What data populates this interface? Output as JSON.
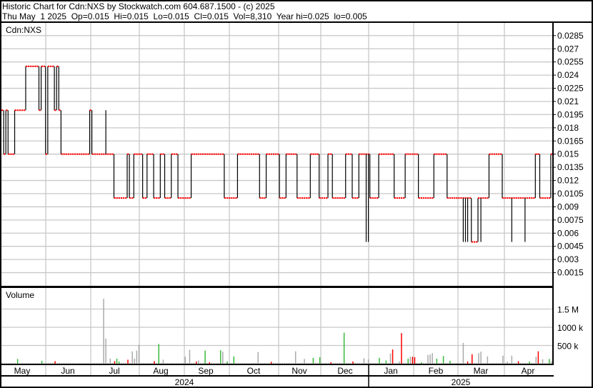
{
  "header": {
    "title": "Historic Chart for Cdn:NXS by Stockwatch.com 604.687.1500 - (c) 2025",
    "quote": "Thu May  1 2025  Op=0.015  Hi=0.015  Lo=0.015  Cl=0.015  Vol=8,310  Year hi=0.025  lo=0.005"
  },
  "colors": {
    "up": "#3cb83c",
    "down": "#ff0000",
    "neutral": "#aaaaaa",
    "close": "#ff0000",
    "range": "#000000",
    "grid": "#c8c8c8"
  },
  "chart_data": [
    {
      "type": "line",
      "title": "Cdn:NXS",
      "ylim": [
        0,
        0.0302
      ],
      "yticks": [
        "0.0285",
        "0.027",
        "0.0255",
        "0.024",
        "0.0225",
        "0.021",
        "0.0195",
        "0.018",
        "0.0165",
        "0.015",
        "0.0135",
        "0.012",
        "0.0105",
        "0.009",
        "0.0075",
        "0.006",
        "0.0045",
        "0.003",
        "0.0015"
      ],
      "trading_days": 250,
      "close_runs": [
        [
          0.02,
          1
        ],
        [
          0.015,
          1
        ],
        [
          0.02,
          1
        ],
        [
          0.015,
          1
        ],
        [
          0.015,
          2
        ],
        [
          0.02,
          5
        ],
        [
          0.025,
          6
        ],
        [
          0.02,
          1
        ],
        [
          0.025,
          2
        ],
        [
          0.015,
          1
        ],
        [
          0.025,
          3
        ],
        [
          0.02,
          1
        ],
        [
          0.025,
          1
        ],
        [
          0.02,
          1
        ],
        [
          0.015,
          13
        ],
        [
          0.02,
          1
        ],
        [
          0.015,
          10
        ],
        [
          0.01,
          6
        ],
        [
          0.015,
          1
        ],
        [
          0.01,
          2
        ],
        [
          0.015,
          4
        ],
        [
          0.01,
          2
        ],
        [
          0.015,
          3
        ],
        [
          0.01,
          3
        ],
        [
          0.015,
          2
        ],
        [
          0.01,
          3
        ],
        [
          0.015,
          3
        ],
        [
          0.01,
          6
        ],
        [
          0.015,
          15
        ],
        [
          0.01,
          6
        ],
        [
          0.015,
          10
        ],
        [
          0.01,
          3
        ],
        [
          0.015,
          6
        ],
        [
          0.01,
          3
        ],
        [
          0.015,
          5
        ],
        [
          0.01,
          6
        ],
        [
          0.015,
          4
        ],
        [
          0.01,
          4
        ],
        [
          0.015,
          2
        ],
        [
          0.01,
          6
        ],
        [
          0.015,
          3
        ],
        [
          0.01,
          3
        ],
        [
          0.015,
          5
        ],
        [
          0.01,
          4
        ],
        [
          0.015,
          7
        ],
        [
          0.01,
          5
        ],
        [
          0.015,
          6
        ],
        [
          0.01,
          7
        ],
        [
          0.015,
          6
        ],
        [
          0.01,
          8
        ],
        [
          0.01,
          3
        ],
        [
          0.005,
          3
        ],
        [
          0.01,
          5
        ],
        [
          0.015,
          6
        ],
        [
          0.01,
          5
        ],
        [
          0.01,
          10
        ],
        [
          0.015,
          2
        ],
        [
          0.01,
          5
        ],
        [
          0.015,
          1
        ]
      ],
      "range_spikes": [
        [
          47,
          0.02
        ],
        [
          165,
          0.005
        ],
        [
          166,
          0.005
        ],
        [
          209,
          0.005
        ],
        [
          210,
          0.005
        ],
        [
          211,
          0.005
        ],
        [
          217,
          0.005
        ],
        [
          231,
          0.005
        ],
        [
          237,
          0.005
        ]
      ]
    },
    {
      "type": "bar",
      "title": "Volume",
      "yticks": [
        {
          "label": "1.5 M",
          "value": 1500
        },
        {
          "label": "1000 k",
          "value": 1000
        },
        {
          "label": "500 k",
          "value": 500
        }
      ],
      "unit": "thousands",
      "default_volume_k": 15,
      "bars": [
        [
          7,
          130,
          "up"
        ],
        [
          18,
          80,
          "up"
        ],
        [
          24,
          70,
          "down"
        ],
        [
          46,
          1780,
          "neutral"
        ],
        [
          47,
          690,
          "neutral"
        ],
        [
          49,
          140,
          "neutral"
        ],
        [
          51,
          70,
          "down"
        ],
        [
          52,
          140,
          "up"
        ],
        [
          53,
          60,
          "up"
        ],
        [
          57,
          110,
          "down"
        ],
        [
          59,
          340,
          "neutral"
        ],
        [
          60,
          140,
          "neutral"
        ],
        [
          61,
          360,
          "neutral"
        ],
        [
          62,
          520,
          "neutral"
        ],
        [
          69,
          70,
          "down"
        ],
        [
          71,
          540,
          "up"
        ],
        [
          73,
          110,
          "neutral"
        ],
        [
          83,
          190,
          "neutral"
        ],
        [
          85,
          380,
          "neutral"
        ],
        [
          88,
          60,
          "down"
        ],
        [
          89,
          90,
          "neutral"
        ],
        [
          92,
          360,
          "up"
        ],
        [
          94,
          40,
          "down"
        ],
        [
          99,
          370,
          "up"
        ],
        [
          100,
          330,
          "neutral"
        ],
        [
          102,
          60,
          "up"
        ],
        [
          105,
          200,
          "up"
        ],
        [
          116,
          320,
          "neutral"
        ],
        [
          122,
          50,
          "down"
        ],
        [
          133,
          340,
          "neutral"
        ],
        [
          137,
          130,
          "neutral"
        ],
        [
          141,
          160,
          "up"
        ],
        [
          144,
          180,
          "up"
        ],
        [
          149,
          40,
          "down"
        ],
        [
          155,
          850,
          "up"
        ],
        [
          159,
          60,
          "down"
        ],
        [
          164,
          150,
          "neutral"
        ],
        [
          166,
          120,
          "neutral"
        ],
        [
          171,
          160,
          "up"
        ],
        [
          174,
          90,
          "up"
        ],
        [
          176,
          280,
          "neutral"
        ],
        [
          177,
          390,
          "down"
        ],
        [
          180,
          60,
          "neutral"
        ],
        [
          181,
          840,
          "down"
        ],
        [
          184,
          140,
          "up"
        ],
        [
          185,
          190,
          "neutral"
        ],
        [
          186,
          190,
          "down"
        ],
        [
          187,
          180,
          "down"
        ],
        [
          190,
          40,
          "up"
        ],
        [
          193,
          240,
          "neutral"
        ],
        [
          194,
          250,
          "neutral"
        ],
        [
          195,
          290,
          "neutral"
        ],
        [
          197,
          140,
          "up"
        ],
        [
          200,
          210,
          "up"
        ],
        [
          203,
          80,
          "up"
        ],
        [
          209,
          570,
          "neutral"
        ],
        [
          211,
          60,
          "down"
        ],
        [
          213,
          260,
          "down"
        ],
        [
          216,
          290,
          "neutral"
        ],
        [
          217,
          330,
          "neutral"
        ],
        [
          220,
          200,
          "neutral"
        ],
        [
          227,
          220,
          "neutral"
        ],
        [
          229,
          60,
          "neutral"
        ],
        [
          231,
          220,
          "neutral"
        ],
        [
          234,
          70,
          "down"
        ],
        [
          239,
          60,
          "up"
        ],
        [
          242,
          190,
          "neutral"
        ],
        [
          243,
          340,
          "down"
        ],
        [
          245,
          120,
          "neutral"
        ],
        [
          248,
          130,
          "up"
        ],
        [
          249,
          70,
          "neutral"
        ]
      ]
    }
  ],
  "xaxis": {
    "months": [
      "May",
      "Jun",
      "Jul",
      "Aug",
      "Sep",
      "Oct",
      "Nov",
      "Dec",
      "Jan",
      "Feb",
      "Mar",
      "Apr"
    ],
    "years": [
      "2024",
      "2025"
    ]
  }
}
